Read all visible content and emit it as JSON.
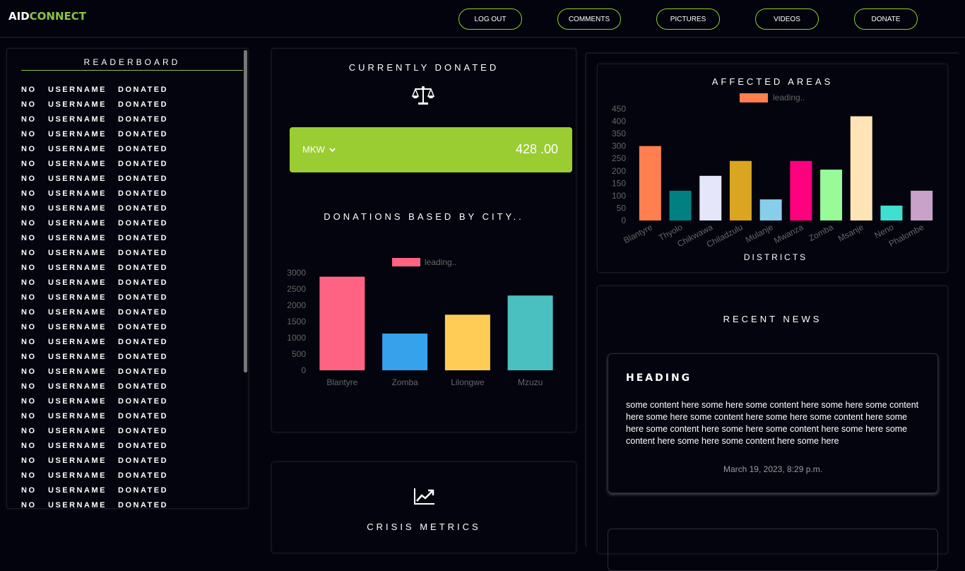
{
  "header": {
    "logo_part1": "AID",
    "logo_part2": "CONNECT",
    "nav": [
      "LOG OUT",
      "COMMENTS",
      "PICTURES",
      "VIDEOS",
      "DONATE"
    ]
  },
  "leaderboard": {
    "title": "READERBOARD",
    "columns": [
      "NO",
      "USERNAME",
      "DONATED"
    ],
    "row_count": 29
  },
  "donated": {
    "title": "CURRENTLY DONATED",
    "icon": "balance-scale-icon",
    "currency": "MKW",
    "amount": "428 .00"
  },
  "city_chart_title": "DONATIONS BASED BY CITY..",
  "metrics": {
    "icon": "trending-up-icon",
    "title": "CRISIS METRICS"
  },
  "areas_title": "AFFECTED AREAS",
  "news": {
    "title": "RECENT NEWS",
    "items": [
      {
        "heading": "HEADING",
        "body": "some content here some here some content here some here some content here some here some content here some here some content here some here some content here some here some content here some here some content here some here some content here some here",
        "date": "March 19, 2023, 8:29 p.m."
      }
    ]
  },
  "chart_data": [
    {
      "type": "bar",
      "title": "DONATIONS BASED BY CITY..",
      "categories": [
        "Blantyre",
        "Zomba",
        "Lilongwe",
        "Mzuzu"
      ],
      "series": [
        {
          "name": "leading..",
          "values": [
            2880,
            1130,
            1710,
            2300
          ]
        }
      ],
      "colors": [
        "#ff6384",
        "#36a2eb",
        "#ffcd56",
        "#4bc0c0"
      ],
      "legend_color": "#ff6384",
      "ylim": [
        0,
        3000
      ],
      "yticks": [
        0,
        500,
        1000,
        1500,
        2000,
        2500,
        3000
      ],
      "legend": "top",
      "grid": false
    },
    {
      "type": "bar",
      "title": "AFFECTED AREAS",
      "xlabel": "DISTRICTS",
      "categories": [
        "Blantyre",
        "Thyolo",
        "Chikwawa",
        "Chiladzulu",
        "Mulanje",
        "Mwanza",
        "Zomba",
        "Msanje",
        "Neno",
        "Phalombe"
      ],
      "series": [
        {
          "name": "leading..",
          "values": [
            300,
            120,
            180,
            240,
            85,
            240,
            205,
            420,
            60,
            120
          ]
        }
      ],
      "colors": [
        "#ff7f50",
        "#008080",
        "#e6e6fa",
        "#daa520",
        "#87ceeb",
        "#ff007f",
        "#98fb98",
        "#ffe4b5",
        "#40e0d0",
        "#c8a2c8"
      ],
      "legend_color": "#ff7f50",
      "ylim": [
        0,
        450
      ],
      "yticks": [
        0,
        50,
        100,
        150,
        200,
        250,
        300,
        350,
        400,
        450
      ],
      "legend": "top",
      "grid": false
    }
  ]
}
